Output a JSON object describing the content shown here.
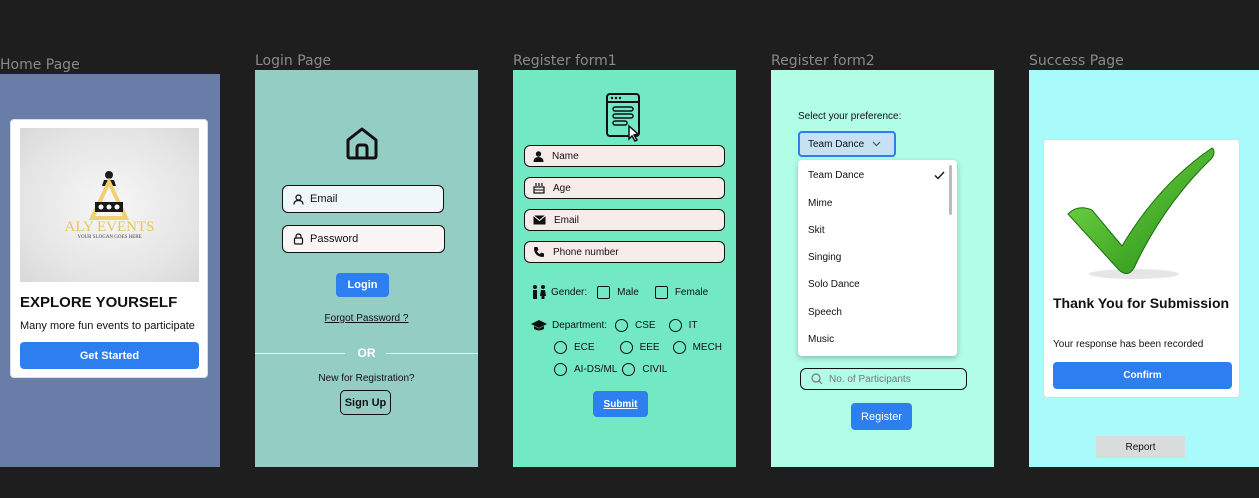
{
  "frames": {
    "home": "Home Page",
    "login": "Login Page",
    "reg1": "Register form1",
    "reg2": "Register form2",
    "success": "Success Page"
  },
  "colors": {
    "accent": "#2d7ff0",
    "home_bg": "#687ea8",
    "login_bg": "#94cdc4",
    "reg1_bg": "#72e9c3",
    "reg2_bg": "#b2fde6",
    "success_bg": "#a9fbfb"
  },
  "home": {
    "logo_name": "ALY EVENTS",
    "logo_slogan": "YOUR SLOGAN GOES HERE",
    "title": "EXPLORE YOURSELF",
    "subtitle": "Many more fun events to participate",
    "cta": "Get Started"
  },
  "login": {
    "email_placeholder": "Email",
    "password_placeholder": "Password",
    "login_button": "Login",
    "forgot": "Forgot Password ?",
    "or": "OR",
    "new_reg": "New for Registration?",
    "signup": "Sign Up"
  },
  "reg1": {
    "fields": [
      "Name",
      "Age",
      "Email",
      "Phone number"
    ],
    "gender_label": "Gender:",
    "gender_options": [
      "Male",
      "Female"
    ],
    "department_label": "Department:",
    "departments": [
      "CSE",
      "IT",
      "ECE",
      "EEE",
      "MECH",
      "AI-DS/ML",
      "CIVIL"
    ],
    "submit": "Submit"
  },
  "reg2": {
    "pref_label": "Select your preference:",
    "selected": "Team Dance",
    "options": [
      "Team Dance",
      "Mime",
      "Skit",
      "Singing",
      "Solo Dance",
      "Speech",
      "Music"
    ],
    "participants_placeholder": "No. of Participants",
    "register": "Register"
  },
  "success": {
    "title": "Thank You for Submission",
    "subtitle": "Your response has been recorded",
    "confirm": "Confirm",
    "report": "Report"
  }
}
